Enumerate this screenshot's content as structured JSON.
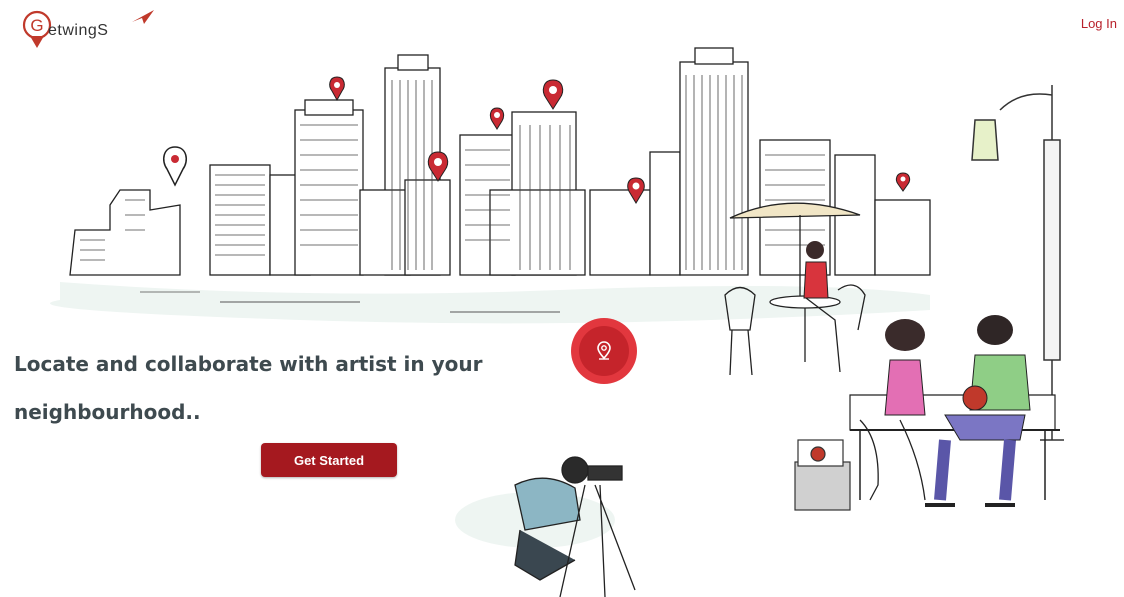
{
  "brand": {
    "name": "etwingS"
  },
  "nav": {
    "login_label": "Log In"
  },
  "hero": {
    "headline": "Locate and collaborate with artist in your neighbourhood..",
    "cta_label": "Get Started"
  },
  "colors": {
    "accent": "#a5191f",
    "pin": "#e2373e",
    "text": "#3e4a4f"
  },
  "icons": {
    "brand": "location-pin-logo-icon",
    "locate": "location-pin-icon"
  }
}
